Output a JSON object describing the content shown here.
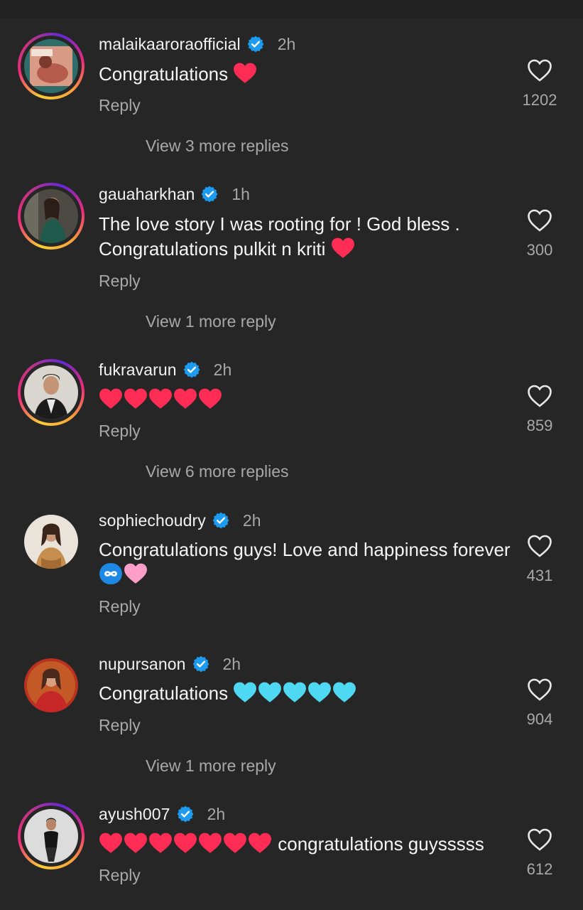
{
  "comments": [
    {
      "username": "malaikaaroraofficial",
      "time": "2h",
      "text": "Congratulations",
      "emojis": [
        "red-heart"
      ],
      "reply_label": "Reply",
      "likes": "1202",
      "more_replies": "View 3 more replies"
    },
    {
      "username": "gauaharkhan",
      "time": "1h",
      "text_line1": "The love story I was rooting for ! God bless .",
      "text_line2": "Congratulations pulkit n kriti",
      "emojis": [
        "red-heart"
      ],
      "reply_label": "Reply",
      "likes": "300",
      "more_replies": "View 1 more reply"
    },
    {
      "username": "fukravarun",
      "time": "2h",
      "text": "",
      "emojis": [
        "red-heart",
        "red-heart",
        "red-heart",
        "red-heart",
        "red-heart"
      ],
      "reply_label": "Reply",
      "likes": "859",
      "more_replies": "View 6 more replies"
    },
    {
      "username": "sophiechoudry",
      "time": "2h",
      "text_line1": "Congratulations guys! Love and happiness forever",
      "emojis": [
        "infinity",
        "pink-heart"
      ],
      "reply_label": "Reply",
      "likes": "431"
    },
    {
      "username": "nupursanon",
      "time": "2h",
      "text": "Congratulations",
      "emojis": [
        "light-blue-heart",
        "light-blue-heart",
        "light-blue-heart",
        "light-blue-heart",
        "light-blue-heart"
      ],
      "reply_label": "Reply",
      "likes": "904",
      "more_replies": "View 1 more reply"
    },
    {
      "username": "ayush007",
      "time": "2h",
      "text": "congratulations guysssss",
      "emojis": [
        "red-heart",
        "red-heart",
        "red-heart",
        "red-heart",
        "red-heart",
        "red-heart",
        "red-heart"
      ],
      "reply_label": "Reply",
      "likes": "612"
    }
  ],
  "icons": {
    "verified": "verified-badge-icon",
    "like": "heart-outline-icon"
  },
  "colors": {
    "background": "#262626",
    "verified": "#1d9bf0",
    "secondary_text": "#a8a8a8",
    "red_heart": "#ff2d55",
    "pink_heart": "#ff9ec8",
    "light_blue_heart": "#4fd8f2",
    "infinity": "#1e88e5"
  }
}
